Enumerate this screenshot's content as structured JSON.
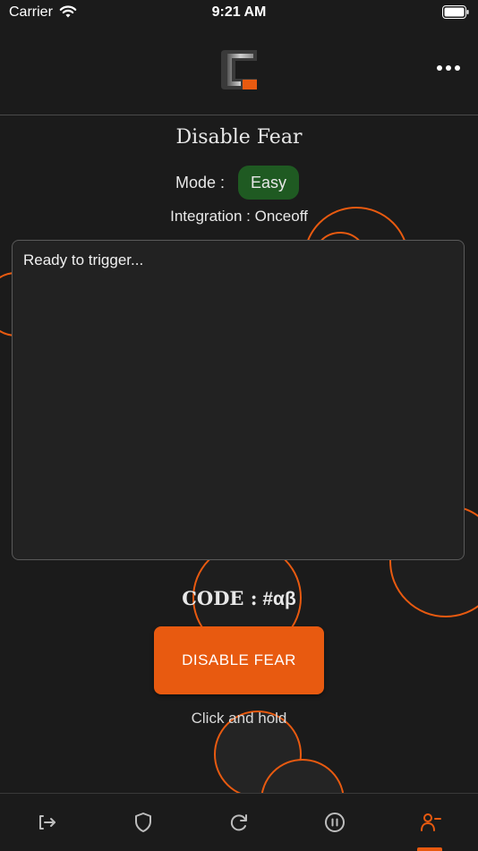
{
  "status_bar": {
    "carrier": "Carrier",
    "time": "9:21 AM"
  },
  "header": {
    "logo_icon": "app-logo-icon",
    "menu_icon": "more-horizontal-icon"
  },
  "main": {
    "title": "Disable Fear",
    "mode_label": "Mode :",
    "mode_value": "Easy",
    "integration": "Integration : Onceoff",
    "log_text": "Ready to trigger...",
    "code_label": "CODE :",
    "code_value": "#αβ",
    "action_button": "DISABLE FEAR",
    "hint": "Click and hold"
  },
  "tabs": [
    {
      "icon": "logout-icon",
      "active": false
    },
    {
      "icon": "shield-icon",
      "active": false
    },
    {
      "icon": "refresh-icon",
      "active": false
    },
    {
      "icon": "pause-icon",
      "active": false
    },
    {
      "icon": "user-minus-icon",
      "active": true
    }
  ],
  "colors": {
    "accent": "#e85a10",
    "badge_green": "#1f5a22",
    "background": "#1b1b1b",
    "inactive_icon": "#bdbdbd"
  }
}
